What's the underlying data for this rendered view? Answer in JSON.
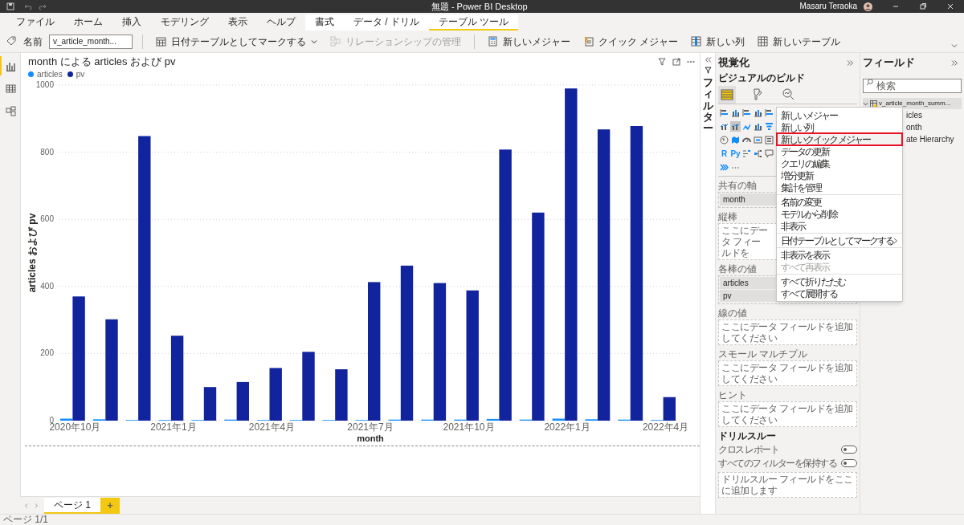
{
  "window": {
    "title": "無題 - Power BI Desktop",
    "user": "Masaru Teraoka"
  },
  "ribbon_tabs": [
    {
      "label": "ファイル",
      "contextual": false,
      "selected": false
    },
    {
      "label": "ホーム",
      "contextual": false,
      "selected": false
    },
    {
      "label": "挿入",
      "contextual": false,
      "selected": false
    },
    {
      "label": "モデリング",
      "contextual": false,
      "selected": false
    },
    {
      "label": "表示",
      "contextual": false,
      "selected": false
    },
    {
      "label": "ヘルプ",
      "contextual": false,
      "selected": false
    },
    {
      "label": "書式",
      "contextual": true,
      "selected": false
    },
    {
      "label": "データ / ドリル",
      "contextual": true,
      "selected": false
    },
    {
      "label": "テーブル ツール",
      "contextual": true,
      "selected": true
    }
  ],
  "toolbar": {
    "name_label": "名前",
    "name_value": "v_article_month...",
    "buttons": [
      {
        "label": "日付テーブルとしてマークする",
        "kind": "calendar",
        "dropdown": true,
        "disabled": false
      },
      {
        "label": "リレーションシップの管理",
        "kind": "relationship",
        "dropdown": false,
        "disabled": true
      },
      {
        "label": "新しいメジャー",
        "kind": "calculator",
        "dropdown": false,
        "disabled": false
      },
      {
        "label": "クイック メジャー",
        "kind": "quick",
        "dropdown": false,
        "disabled": false
      },
      {
        "label": "新しい列",
        "kind": "column",
        "dropdown": false,
        "disabled": false
      },
      {
        "label": "新しいテーブル",
        "kind": "table",
        "dropdown": false,
        "disabled": false
      }
    ]
  },
  "left_nav": [
    {
      "kind": "report",
      "selected": true
    },
    {
      "kind": "data",
      "selected": false
    },
    {
      "kind": "model",
      "selected": false
    }
  ],
  "visual": {
    "chart_data": {
      "type": "bar",
      "title": "month による articles および pv",
      "xlabel": "month",
      "ylabel": "articles および pv",
      "categories": [
        "2020年10月",
        null,
        null,
        "2021年1月",
        null,
        null,
        "2021年4月",
        null,
        null,
        "2021年7月",
        null,
        null,
        "2021年10月",
        null,
        null,
        "2022年1月",
        null,
        null,
        "2022年4月"
      ],
      "series": [
        {
          "name": "articles",
          "color": "#118dff",
          "values": [
            6,
            4,
            2,
            2,
            2,
            3,
            2,
            2,
            2,
            2,
            3,
            3,
            3,
            5,
            3,
            6,
            4,
            3,
            2
          ]
        },
        {
          "name": "pv",
          "color": "#12239e",
          "values": [
            370,
            302,
            848,
            253,
            100,
            115,
            157,
            205,
            153,
            413,
            462,
            410,
            388,
            808,
            620,
            990,
            868,
            878,
            70
          ]
        }
      ],
      "ylim": [
        0,
        1000
      ],
      "yticks": [
        0,
        200,
        400,
        600,
        800,
        1000
      ],
      "grid": true
    }
  },
  "filters_pane": {
    "label": "フィルター"
  },
  "visualizations_pane": {
    "title": "視覚化",
    "subtitle": "ビジュアルのビルド",
    "modes": [
      {
        "kind": "build",
        "selected": true
      },
      {
        "kind": "format",
        "selected": false
      },
      {
        "kind": "analytics",
        "selected": false
      }
    ],
    "visual_types": [
      {
        "kind": "hbar",
        "selected": false
      },
      {
        "kind": "vbar",
        "selected": false
      },
      {
        "kind": "hbar",
        "selected": false
      },
      {
        "kind": "vbar",
        "selected": false
      },
      {
        "kind": "hbar",
        "selected": false
      },
      {
        "kind": "combo",
        "selected": false
      },
      {
        "kind": "combo",
        "selected": true
      },
      {
        "kind": "ribbon",
        "selected": false
      },
      {
        "kind": "vbar",
        "selected": false
      },
      {
        "kind": "funnel",
        "selected": false
      },
      {
        "kind": "globe",
        "selected": false
      },
      {
        "kind": "map",
        "selected": false
      },
      {
        "kind": "gauge",
        "selected": false
      },
      {
        "kind": "card",
        "selected": false
      },
      {
        "kind": "list",
        "selected": false
      },
      {
        "kind": "script",
        "label": "R",
        "selected": false
      },
      {
        "kind": "script",
        "label": "Py",
        "selected": false
      },
      {
        "kind": "tree",
        "selected": false
      },
      {
        "kind": "flow",
        "selected": false
      },
      {
        "kind": "qa",
        "selected": false
      },
      {
        "kind": "apps",
        "selected": false
      },
      {
        "kind": "more",
        "selected": false
      }
    ],
    "wells": [
      {
        "label": "共有の軸",
        "fields": [
          "month"
        ]
      },
      {
        "label": "縦棒",
        "hint": "ここにデータ フィールドを"
      },
      {
        "label": "各棒の値",
        "fields": [
          "articles",
          "pv"
        ]
      },
      {
        "label": "線の値",
        "hint": "ここにデータ フィールドを追加してください"
      },
      {
        "label": "スモール マルチプル",
        "hint": "ここにデータ フィールドを追加してください"
      },
      {
        "label": "ヒント",
        "hint": "ここにデータ フィールドを追加してください"
      }
    ],
    "drillthrough": {
      "title": "ドリルスルー",
      "toggles": [
        {
          "label": "クロス レポート",
          "on": false
        },
        {
          "label": "すべてのフィルターを保持する",
          "on": false
        }
      ],
      "hint": "ドリルスルー フィールドをここに追加します"
    }
  },
  "fields_pane": {
    "title": "フィールド",
    "search_placeholder": "検索",
    "tables": [
      {
        "name": "v_article_month_summ...",
        "expanded": true,
        "children": [
          {
            "name": "icles"
          },
          {
            "name": "onth"
          },
          {
            "name": "ate Hierarchy"
          }
        ]
      }
    ]
  },
  "context_menu": {
    "groups": [
      [
        {
          "label": "新しいメジャー",
          "highlighted": false,
          "disabled": false,
          "submenu": false
        },
        {
          "label": "新しい列",
          "highlighted": false,
          "disabled": false,
          "submenu": false
        },
        {
          "label": "新しいクイック メジャー",
          "highlighted": true,
          "disabled": false,
          "submenu": false
        },
        {
          "label": "データの更新",
          "highlighted": false,
          "disabled": false,
          "submenu": false
        },
        {
          "label": "クエリの編集",
          "highlighted": false,
          "disabled": false,
          "submenu": false
        },
        {
          "label": "増分更新",
          "highlighted": false,
          "disabled": false,
          "submenu": false
        },
        {
          "label": "集計を管理",
          "highlighted": false,
          "disabled": false,
          "submenu": false
        }
      ],
      [
        {
          "label": "名前の変更",
          "highlighted": false,
          "disabled": false,
          "submenu": false
        },
        {
          "label": "モデルから削除",
          "highlighted": false,
          "disabled": false,
          "submenu": false
        },
        {
          "label": "非表示",
          "highlighted": false,
          "disabled": false,
          "submenu": false
        }
      ],
      [
        {
          "label": "日付テーブルとしてマークする",
          "highlighted": false,
          "disabled": false,
          "submenu": true
        }
      ],
      [
        {
          "label": "非表示を表示",
          "highlighted": false,
          "disabled": false,
          "submenu": false
        },
        {
          "label": "すべて再表示",
          "highlighted": false,
          "disabled": true,
          "submenu": false
        }
      ],
      [
        {
          "label": "すべて折りたたむ",
          "highlighted": false,
          "disabled": false,
          "submenu": false
        },
        {
          "label": "すべて展開する",
          "highlighted": false,
          "disabled": false,
          "submenu": false
        }
      ]
    ]
  },
  "page_tabs": {
    "pages": [
      {
        "label": "ページ 1",
        "selected": true
      }
    ],
    "add_label": "+"
  },
  "status_bar": "ページ 1/1"
}
